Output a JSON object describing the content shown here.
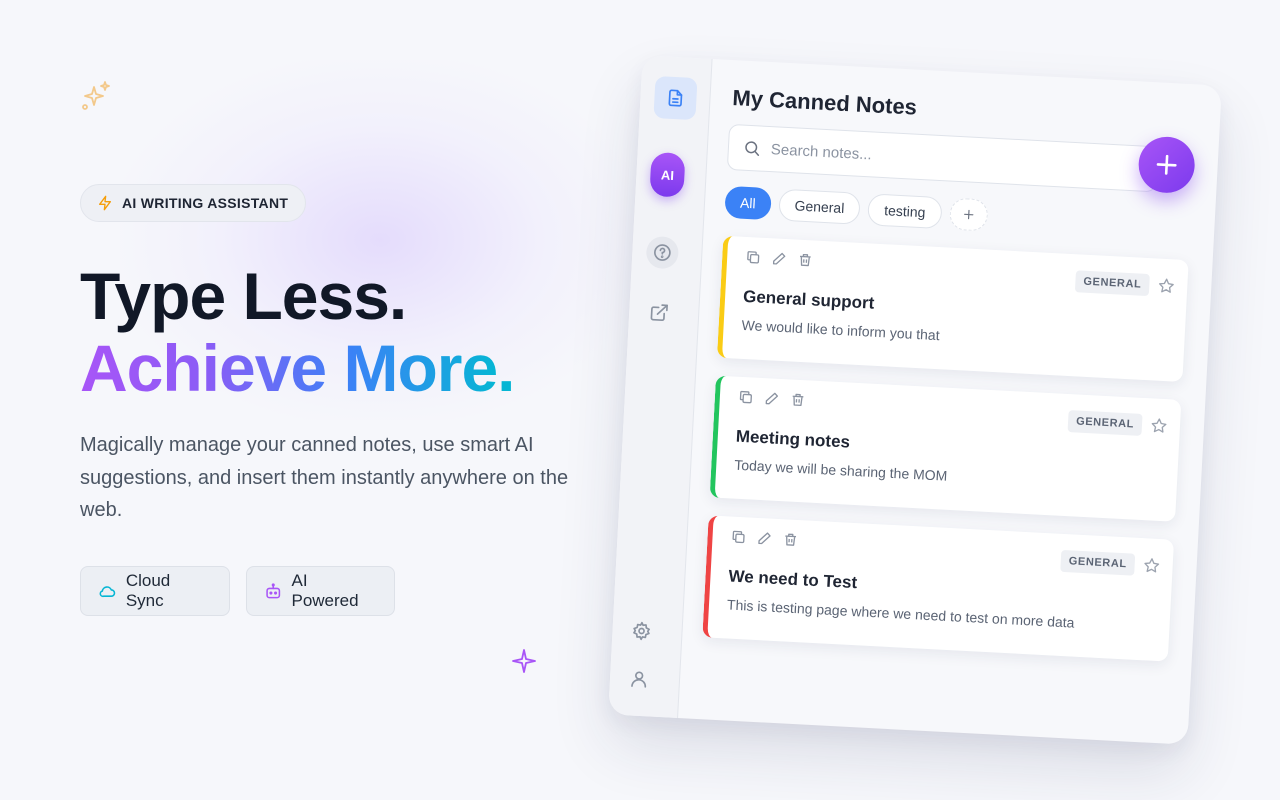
{
  "hero": {
    "badge": "AI WRITING ASSISTANT",
    "headline_line1": "Type Less.",
    "headline_line2": "Achieve More",
    "headline_dot": ".",
    "description": "Magically manage your canned notes, use smart AI suggestions, and insert them instantly anywhere on the web.",
    "features": [
      {
        "label": "Cloud Sync",
        "icon": "cloud-icon"
      },
      {
        "label": "AI Powered",
        "icon": "bot-icon"
      }
    ]
  },
  "app": {
    "title": "My Canned Notes",
    "search": {
      "placeholder": "Search notes...",
      "value": ""
    },
    "sidebar": {
      "ai_label": "AI"
    },
    "filters": [
      "All",
      "General",
      "testing"
    ],
    "active_filter": "All",
    "notes": [
      {
        "title": "General support",
        "body": "We would like to inform you that",
        "tag": "GENERAL",
        "accent": "#facc15"
      },
      {
        "title": "Meeting notes",
        "body": "Today we will be sharing the MOM",
        "tag": "GENERAL",
        "accent": "#22c55e"
      },
      {
        "title": "We need to Test",
        "body": "This is testing page where we need to test on more data",
        "tag": "GENERAL",
        "accent": "#ef4444"
      }
    ]
  },
  "colors": {
    "brand_purple": "#7c3aed",
    "brand_blue": "#3b82f6",
    "brand_cyan": "#06b6d4"
  }
}
